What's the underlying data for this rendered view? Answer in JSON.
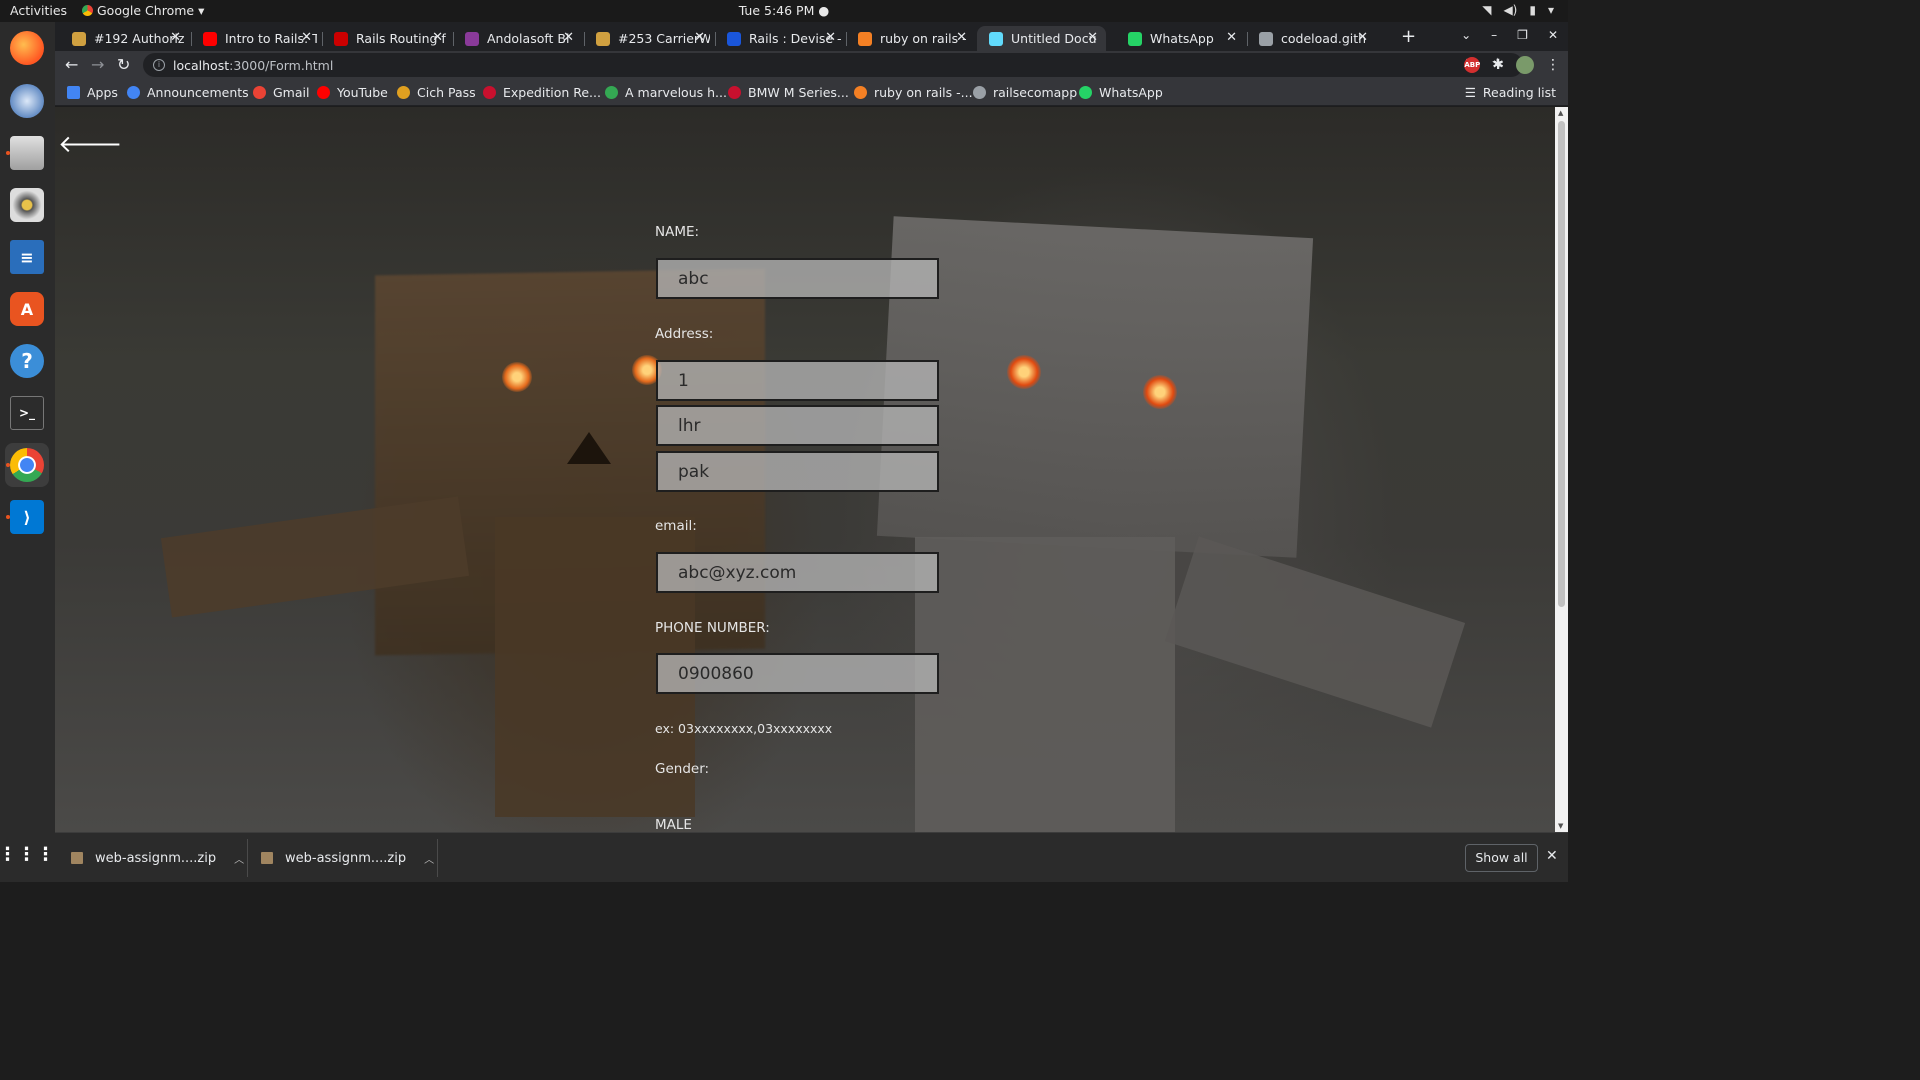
{
  "topbar": {
    "activities": "Activities",
    "app_name": "Google Chrome",
    "clock": "Tue  5:46 PM"
  },
  "dock": {
    "items": [
      "firefox-icon",
      "thunderbird-icon",
      "files-icon",
      "rhythmbox-icon",
      "writer-icon",
      "software-icon",
      "help-icon",
      "terminal-icon",
      "chrome-icon",
      "vscode-icon"
    ]
  },
  "tabs": [
    {
      "title": "#192 Authoriz",
      "color": "#d0a040"
    },
    {
      "title": "Intro to Rails: T",
      "color": "#ff0000"
    },
    {
      "title": "Rails Routing f",
      "color": "#cc0000"
    },
    {
      "title": "Andolasoft Bl",
      "color": "#8a3a9a"
    },
    {
      "title": "#253 CarrierW",
      "color": "#d0a040"
    },
    {
      "title": "Rails : Devise -",
      "color": "#1a56db"
    },
    {
      "title": "ruby on rails - ",
      "color": "#f48024"
    },
    {
      "title": "Untitled Docu",
      "color": "#61dafb"
    },
    {
      "title": "WhatsApp",
      "color": "#25d366"
    },
    {
      "title": "codeload.gith",
      "color": "#9aa0a6"
    }
  ],
  "omnibox": {
    "host": "localhost",
    "path": ":3000/Form.html"
  },
  "bookmarks": [
    {
      "label": "Apps",
      "color": "#4285f4"
    },
    {
      "label": "Announcements",
      "color": "#4285f4"
    },
    {
      "label": "Gmail",
      "color": "#ea4335"
    },
    {
      "label": "YouTube",
      "color": "#ff0000"
    },
    {
      "label": "Cich Pass",
      "color": "#e0a020"
    },
    {
      "label": "Expedition Re...",
      "color": "#c8102e"
    },
    {
      "label": "A marvelous h...",
      "color": "#34a853"
    },
    {
      "label": "BMW M Series...",
      "color": "#c8102e"
    },
    {
      "label": "ruby on rails -...",
      "color": "#f48024"
    },
    {
      "label": "railsecomapp",
      "color": "#9aa0a6"
    },
    {
      "label": "WhatsApp",
      "color": "#25d366"
    }
  ],
  "reading_list": "Reading list",
  "form": {
    "name_label": "NAME:",
    "name_value": "abc",
    "address_label": "Address:",
    "address_line1": "1",
    "address_line2": "lhr",
    "address_line3": "pak",
    "email_label": "email:",
    "email_value": "abc@xyz.com",
    "phone_label": "PHONE NUMBER:",
    "phone_value": "0900860",
    "phone_hint": "ex: 03xxxxxxxx,03xxxxxxxx",
    "gender_label": "Gender:",
    "male_label": "MALE"
  },
  "downloads": {
    "items": [
      "web-assignm....zip",
      "web-assignm....zip"
    ],
    "show_all": "Show all"
  }
}
